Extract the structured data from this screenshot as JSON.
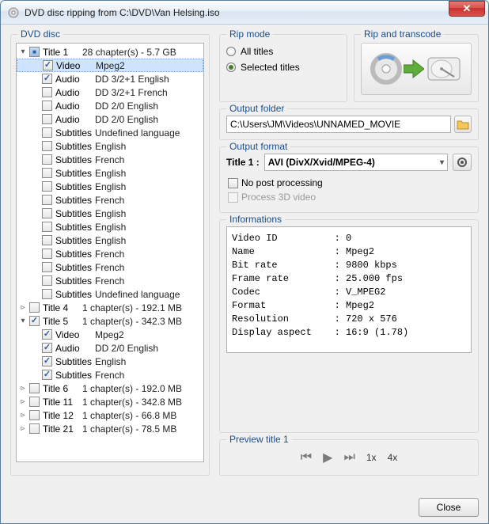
{
  "window": {
    "title": "DVD disc ripping from C:\\DVD\\Van Helsing.iso"
  },
  "tree": {
    "legend": "DVD disc",
    "rows": [
      {
        "exp": "▾",
        "ind": 0,
        "chk": "mix",
        "label": "Title 1",
        "val": "28 chapter(s) - 5.7 GB"
      },
      {
        "exp": "",
        "ind": 1,
        "chk": "on",
        "label": "Video",
        "val": "Mpeg2",
        "sel": true
      },
      {
        "exp": "",
        "ind": 1,
        "chk": "on",
        "label": "Audio",
        "val": "DD 3/2+1 English"
      },
      {
        "exp": "",
        "ind": 1,
        "chk": "",
        "label": "Audio",
        "val": "DD 3/2+1 French"
      },
      {
        "exp": "",
        "ind": 1,
        "chk": "",
        "label": "Audio",
        "val": "DD 2/0 English"
      },
      {
        "exp": "",
        "ind": 1,
        "chk": "",
        "label": "Audio",
        "val": "DD 2/0 English"
      },
      {
        "exp": "",
        "ind": 1,
        "chk": "",
        "label": "Subtitles",
        "val": "Undefined language"
      },
      {
        "exp": "",
        "ind": 1,
        "chk": "",
        "label": "Subtitles",
        "val": "English"
      },
      {
        "exp": "",
        "ind": 1,
        "chk": "",
        "label": "Subtitles",
        "val": "French"
      },
      {
        "exp": "",
        "ind": 1,
        "chk": "",
        "label": "Subtitles",
        "val": "English"
      },
      {
        "exp": "",
        "ind": 1,
        "chk": "",
        "label": "Subtitles",
        "val": "English"
      },
      {
        "exp": "",
        "ind": 1,
        "chk": "",
        "label": "Subtitles",
        "val": "French"
      },
      {
        "exp": "",
        "ind": 1,
        "chk": "",
        "label": "Subtitles",
        "val": "English"
      },
      {
        "exp": "",
        "ind": 1,
        "chk": "",
        "label": "Subtitles",
        "val": "English"
      },
      {
        "exp": "",
        "ind": 1,
        "chk": "",
        "label": "Subtitles",
        "val": "English"
      },
      {
        "exp": "",
        "ind": 1,
        "chk": "",
        "label": "Subtitles",
        "val": "French"
      },
      {
        "exp": "",
        "ind": 1,
        "chk": "",
        "label": "Subtitles",
        "val": "French"
      },
      {
        "exp": "",
        "ind": 1,
        "chk": "",
        "label": "Subtitles",
        "val": "French"
      },
      {
        "exp": "",
        "ind": 1,
        "chk": "",
        "label": "Subtitles",
        "val": "Undefined language"
      },
      {
        "exp": "▹",
        "ind": 0,
        "chk": "",
        "label": "Title 4",
        "val": "1 chapter(s) - 192.1 MB"
      },
      {
        "exp": "▾",
        "ind": 0,
        "chk": "on",
        "label": "Title 5",
        "val": "1 chapter(s) - 342.3 MB"
      },
      {
        "exp": "",
        "ind": 1,
        "chk": "on",
        "label": "Video",
        "val": "Mpeg2"
      },
      {
        "exp": "",
        "ind": 1,
        "chk": "on",
        "label": "Audio",
        "val": "DD 2/0 English"
      },
      {
        "exp": "",
        "ind": 1,
        "chk": "on",
        "label": "Subtitles",
        "val": "English"
      },
      {
        "exp": "",
        "ind": 1,
        "chk": "on",
        "label": "Subtitles",
        "val": "French"
      },
      {
        "exp": "▹",
        "ind": 0,
        "chk": "",
        "label": "Title 6",
        "val": "1 chapter(s) - 192.0 MB"
      },
      {
        "exp": "▹",
        "ind": 0,
        "chk": "",
        "label": "Title 11",
        "val": "1 chapter(s) - 342.8 MB"
      },
      {
        "exp": "▹",
        "ind": 0,
        "chk": "",
        "label": "Title 12",
        "val": "1 chapter(s) - 66.8 MB"
      },
      {
        "exp": "▹",
        "ind": 0,
        "chk": "",
        "label": "Title 21",
        "val": "1 chapter(s) - 78.5 MB"
      }
    ]
  },
  "ripmode": {
    "legend": "Rip mode",
    "all": "All titles",
    "sel": "Selected titles"
  },
  "transcode": {
    "legend": "Rip and transcode"
  },
  "outfolder": {
    "legend": "Output folder",
    "path": "C:\\Users\\JM\\Videos\\UNNAMED_MOVIE"
  },
  "outformat": {
    "legend": "Output format",
    "title": "Title 1 :",
    "fmt": "AVI (DivX/Xvid/MPEG-4)",
    "nopost": "No post processing",
    "p3d": "Process 3D video"
  },
  "info": {
    "legend": "Informations",
    "text": "Video ID          : 0\nName              : Mpeg2\nBit rate          : 9800 kbps\nFrame rate        : 25.000 fps\nCodec             : V_MPEG2\nFormat            : Mpeg2\nResolution        : 720 x 576\nDisplay aspect    : 16:9 (1.78)"
  },
  "preview": {
    "legend": "Preview title 1",
    "s1": "1x",
    "s4": "4x"
  },
  "footer": {
    "close": "Close"
  }
}
